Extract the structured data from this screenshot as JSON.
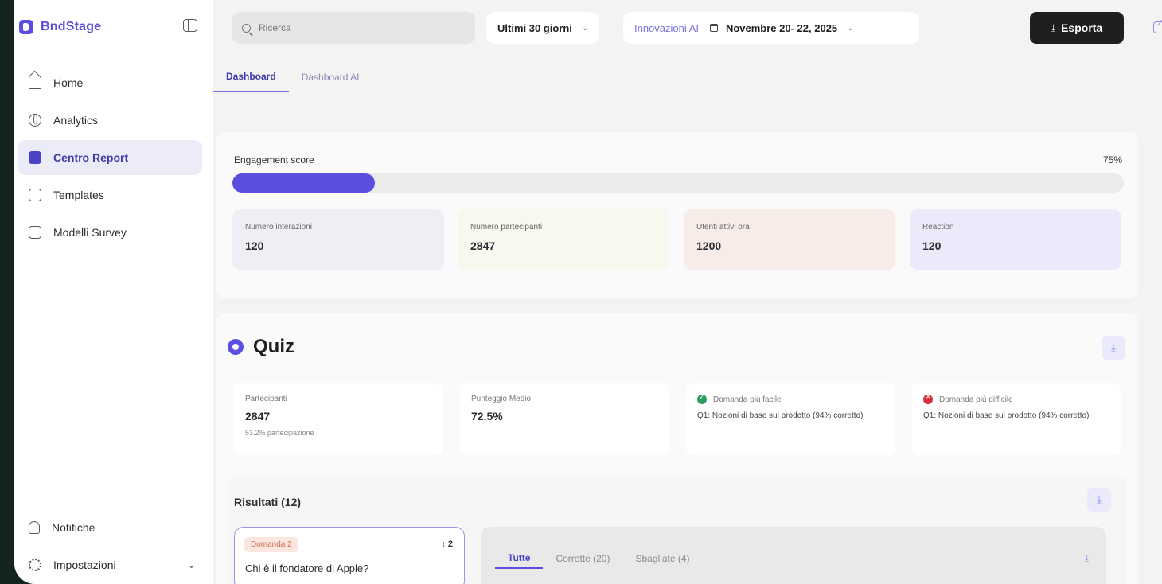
{
  "brand": {
    "name": "BndStage"
  },
  "sidebar": {
    "items": [
      {
        "label": "Home",
        "icon": "home-icon"
      },
      {
        "label": "Analytics",
        "icon": "globe-icon"
      },
      {
        "label": "Centro Report",
        "icon": "clipboard-icon",
        "active": true
      },
      {
        "label": "Templates",
        "icon": "templates-icon"
      },
      {
        "label": "Modelli Survey",
        "icon": "survey-icon"
      }
    ],
    "bottom": [
      {
        "label": "Notifiche",
        "icon": "bell-icon"
      },
      {
        "label": "Impostazioni",
        "icon": "gear-icon"
      }
    ]
  },
  "topbar": {
    "search_placeholder": "Ricerca",
    "period": "Ultimi 30 giorni",
    "event_name": "Innovazioni AI",
    "event_dates": "Novembre 20- 22, 2025",
    "export_label": "Esporta"
  },
  "tabs": [
    {
      "label": "Dashboard",
      "active": true
    },
    {
      "label": "Dashboard AI",
      "active": false
    }
  ],
  "engagement": {
    "label": "Engagement score",
    "percent_text": "75%",
    "bar_fill_fraction": 0.16,
    "stats": [
      {
        "label": "Numero interazioni",
        "value": "120",
        "color": "#efeef5"
      },
      {
        "label": "Numero partecipanti",
        "value": "2847",
        "color": "#f8f8ee"
      },
      {
        "label": "Utenti attivi ora",
        "value": "1200",
        "color": "#f8ece9"
      },
      {
        "label": "Reaction",
        "value": "120",
        "color": "#ebeafa"
      }
    ]
  },
  "quiz": {
    "title": "Quiz",
    "stats": {
      "participants": {
        "label": "Partecipanti",
        "value": "2847",
        "sub": "53.2% partecipazione"
      },
      "avg_score": {
        "label": "Punteggio Medio",
        "value": "72.5%"
      },
      "easiest": {
        "label": "Domanda più facile",
        "text": "Q1: Nozioni di base sul prodotto (94% corretto)"
      },
      "hardest": {
        "label": "Domanda più difficile",
        "text": "Q1: Nozioni di base sul prodotto (94% corretto)"
      }
    },
    "results": {
      "title": "Risultati (12)",
      "question_badge": "Domanda 2",
      "question_rank": "↕ 2",
      "question_text": "Chi è il fondatore di Apple?",
      "answer_tabs": [
        "Tutte",
        "Corrette (20)",
        "Sbagliate (4)"
      ]
    }
  },
  "colors": {
    "accent": "#5b4fe0",
    "success": "#2e9d5c",
    "danger": "#d8303a"
  }
}
